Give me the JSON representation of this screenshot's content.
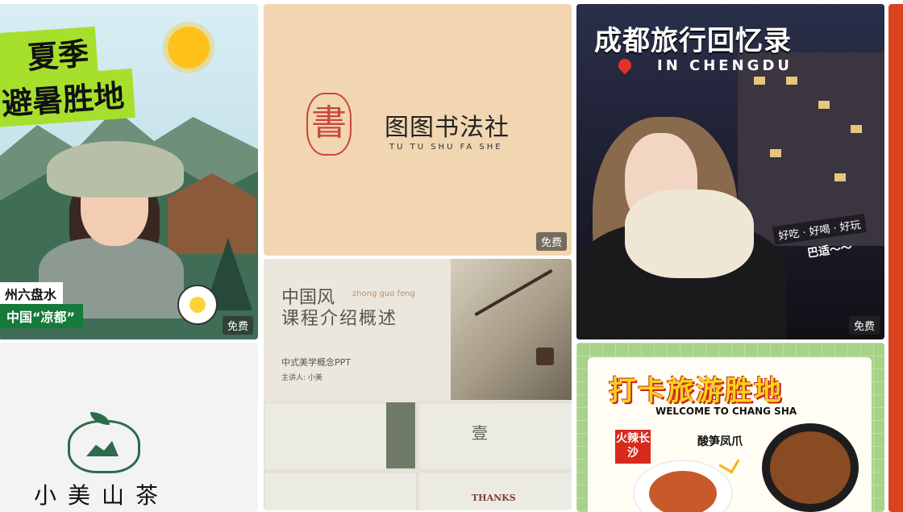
{
  "badges": {
    "free": "免费"
  },
  "summer": {
    "title_line1": "夏季",
    "title_line2": "避暑胜地",
    "location": "州六盘水",
    "tagline": "中国“凉都”"
  },
  "calligraphy": {
    "seal_char": "書",
    "name": "图图书法社",
    "pinyin": "TU TU SHU FA SHE"
  },
  "chinese_style": {
    "title_line1": "中国风",
    "title_pinyin": "zhong guo feng",
    "title_line2": "课程介绍概述",
    "subtitle": "中式美学概念PPT",
    "presenter": "主讲人: 小美",
    "slide_number": "壹",
    "thanks": "THANKS"
  },
  "chengdu": {
    "title": "成都旅行回忆录",
    "subtitle": "IN CHENGDU",
    "tags": "好吃 · 好喝 · 好玩",
    "tagline": "巴适～～"
  },
  "tea": {
    "brand": "小美山茶"
  },
  "changsha": {
    "title": "打卡旅游胜地",
    "welcome": "WELCOME TO CHANG SHA",
    "tag": "火辣长沙",
    "dish": "酸笋凤爪"
  },
  "colors": {
    "summer_green": "#a6e02c",
    "calligraphy_bg": "#f1d6b1",
    "changsha_bg": "#a8d28a",
    "seal_red": "#c9483b"
  }
}
